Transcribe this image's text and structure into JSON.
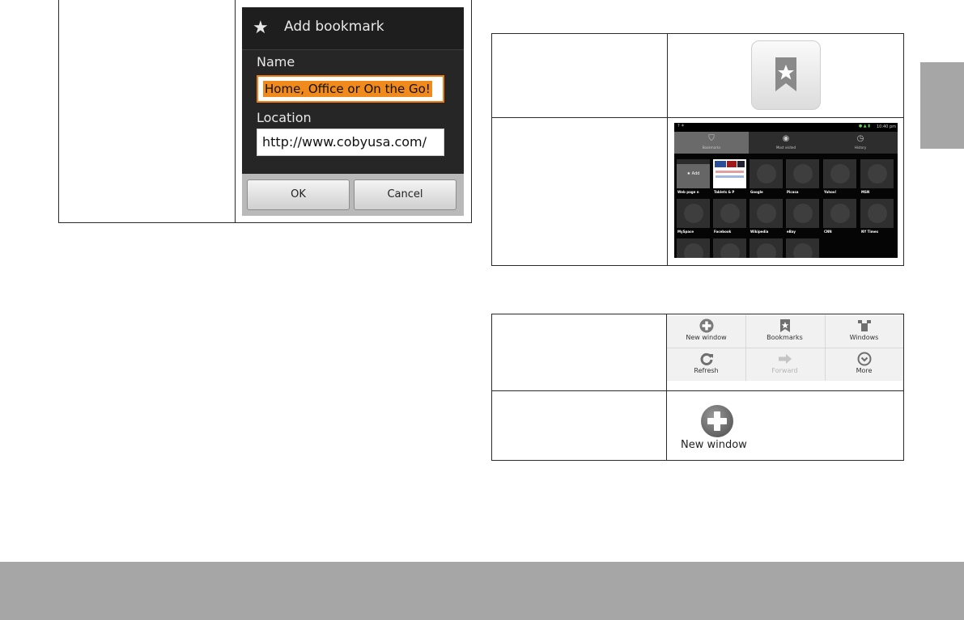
{
  "dialog": {
    "title": "Add bookmark",
    "name_label": "Name",
    "name_value": "Home, Office or On the Go!",
    "location_label": "Location",
    "location_value": "http://www.cobyusa.com/",
    "ok_label": "OK",
    "cancel_label": "Cancel"
  },
  "browser": {
    "status_time": "10:40 pm",
    "tabs": [
      "Bookmarks",
      "Most visited",
      "History"
    ],
    "add_label": "★ Add",
    "tiles_row1": [
      "Web page n",
      "Tablets & P",
      "Google",
      "Picasa",
      "Yahoo!",
      "MSN"
    ],
    "tiles_row2": [
      "MySpace",
      "Facebook",
      "Wikipedia",
      "eBay",
      "CNN",
      "NY Times"
    ]
  },
  "menu": {
    "items": [
      "New window",
      "Bookmarks",
      "Windows",
      "Refresh",
      "Forward",
      "More"
    ]
  },
  "new_window": {
    "label": "New window"
  },
  "colors": {
    "accent": "#f07d12",
    "tab_gray": "#a6a6a6",
    "border": "#2a2a2a"
  }
}
